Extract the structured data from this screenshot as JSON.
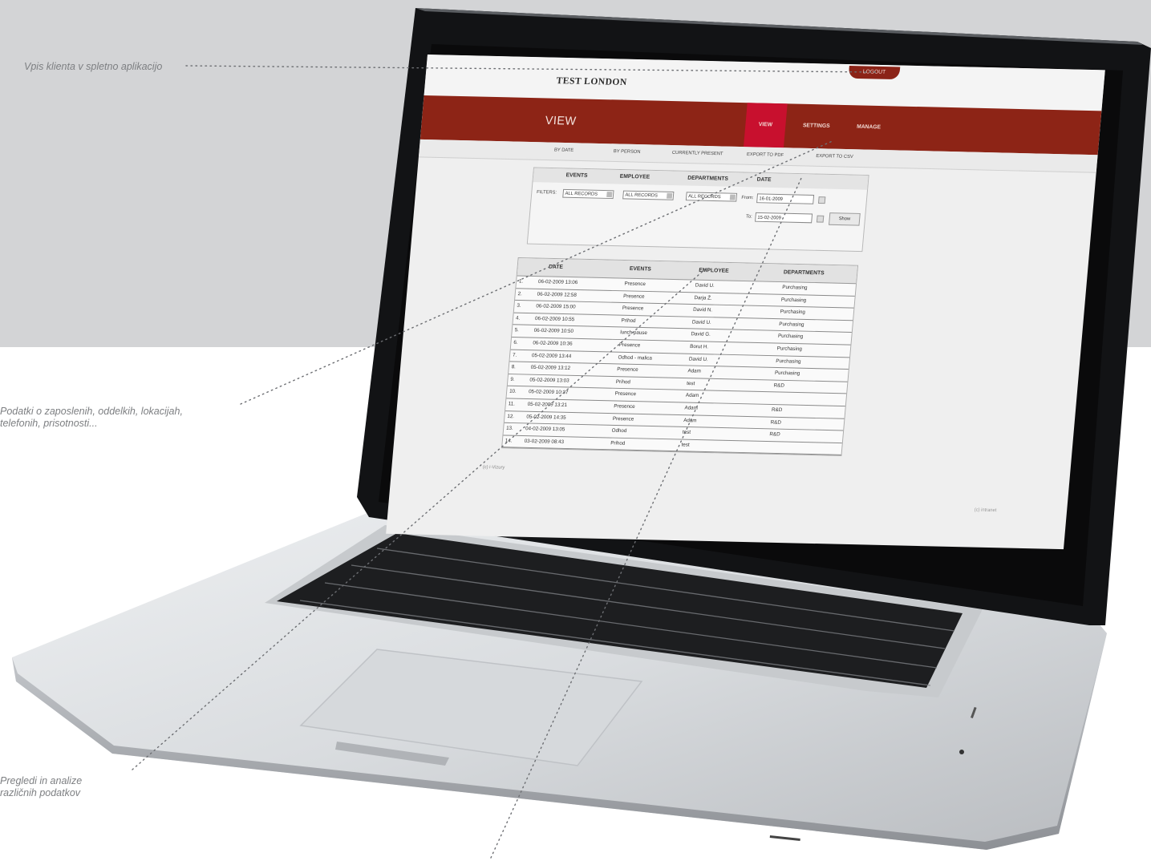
{
  "annotations": [
    {
      "id": "annot-1",
      "text": "Vpis klienta v spletno aplikacijo"
    },
    {
      "id": "annot-2",
      "line1": "Podatki o zaposlenih, oddelkih, lokacijah,",
      "line2": "telefonih, prisotnosti..."
    },
    {
      "id": "annot-3",
      "line1": "Pregledi in analize",
      "line2": "različnih podatkov"
    }
  ],
  "app": {
    "brand": "TEST LONDON",
    "logout_label": "LOGOUT",
    "page_title": "VIEW",
    "nav_tabs": [
      "VIEW",
      "SETTINGS",
      "MANAGE"
    ],
    "subnav": [
      "BY DATE",
      "BY PERSON",
      "CURRENTLY PRESENT",
      "EXPORT TO PDF",
      "EXPORT TO CSV"
    ],
    "filter": {
      "headers": [
        "EVENTS",
        "EMPLOYEE",
        "DEPARTMENTS",
        "DATE"
      ],
      "label": "FILTERS:",
      "events_value": "ALL RECORDS",
      "employee_value": "ALL RECORDS",
      "departments_value": "ALL RECORDS",
      "from_label": "From:",
      "from_value": "16-01-2009",
      "to_label": "To:",
      "to_value": "15-02-2009",
      "show_label": "Show"
    },
    "table": {
      "headers": [
        "DATE",
        "EVENTS",
        "EMPLOYEE",
        "DEPARTMENTS"
      ],
      "rows": [
        [
          "1.",
          "06-02-2009 13:06",
          "Presence",
          "David U.",
          "Purchasing"
        ],
        [
          "2.",
          "06-02-2009 12:58",
          "Presence",
          "Darja Ž.",
          "Purchasing"
        ],
        [
          "3.",
          "06-02-2009 15:00",
          "Presence",
          "David N.",
          "Purchasing"
        ],
        [
          "4.",
          "06-02-2009 10:55",
          "Prihod",
          "David U.",
          "Purchasing"
        ],
        [
          "5.",
          "06-02-2009 10:50",
          "lunch pause",
          "David G.",
          "Purchasing"
        ],
        [
          "6.",
          "06-02-2009 10:36",
          "Presence",
          "Borut H.",
          "Purchasing"
        ],
        [
          "7.",
          "05-02-2009 13:44",
          "Odhod - malica",
          "David U.",
          "Purchasing"
        ],
        [
          "8.",
          "05-02-2009 13:12",
          "Presence",
          "Adam",
          "Purchasing"
        ],
        [
          "9.",
          "05-02-2009 13:03",
          "Prihod",
          "test",
          "R&D"
        ],
        [
          "10.",
          "05-02-2009 10:37",
          "Presence",
          "Adam",
          ""
        ],
        [
          "11.",
          "05-02-2009 13:21",
          "Presence",
          "Adam",
          "R&D"
        ],
        [
          "12.",
          "05-02-2009 14:35",
          "Presence",
          "Adam",
          "R&D"
        ],
        [
          "13.",
          "04-02-2009 13:05",
          "Odhod",
          "test",
          "R&D"
        ],
        [
          "14.",
          "03-02-2009 08:43",
          "Prihod",
          "test",
          ""
        ]
      ]
    },
    "footer_left": "(c) i-Vizury",
    "footer_right": "(c) intranet"
  },
  "colors": {
    "nav_bg": "#8d2416",
    "active_tab": "#c8102e",
    "bg_gray": "#d3d4d6",
    "annotation_text": "#7d7f82"
  }
}
